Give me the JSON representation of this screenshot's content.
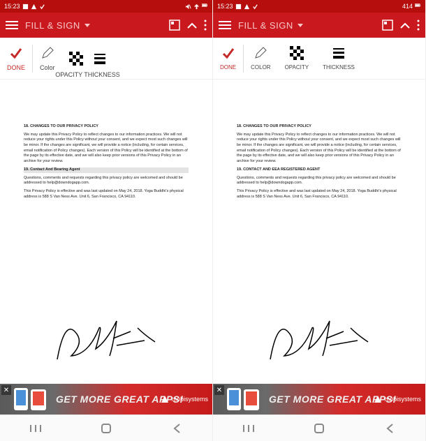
{
  "status": {
    "time": "15:23",
    "battery_right_a": "",
    "battery_right_b": "414"
  },
  "header": {
    "title": "FILL & SIGN"
  },
  "toolbar": {
    "left": {
      "done": "DONE",
      "color": "Color",
      "opacity": "OPACITY",
      "thickness": "THICKNESS",
      "opacity_thickness": "OPACITY THICKNESS"
    },
    "right": {
      "done": "DONE",
      "color": "COLOR",
      "opacity": "OPACITY",
      "thickness": "THICKNESS"
    }
  },
  "doc": {
    "section18_title": "18. CHANGES TO OUR PRIVACY POLICY",
    "section18_body": "We may update this Privacy Policy to reflect changes to our information practices. We will not reduce your rights under this Policy without your consent, and we expect most such changes will be minor. If the changes are significant, we will provide a notice (including, for certain services, email notification of Policy changes). Each version of this Policy will be identified at the bottom of the page by its effective date, and we will also keep prior versions of this Privacy Policy in an archive for your review.",
    "section19_title_a": "19. Contact And Bearing Agent",
    "section19_title_b": "19. CONTACT AND EEA REGISTERED AGENT",
    "section19_body1": "Questions, comments and requests regarding this privacy policy are welcomed and should be addressed to help@downdogapp.com.",
    "section19_body2": "This Privacy Policy is effective and was last updated on May 24, 2018. Yoga Buddhi's physical address is 588 S Van Ness Ave. Unit 6, San Francisco, CA 94110."
  },
  "ad": {
    "text": "GET MORE GREAT APPS!",
    "brand": "mobisystems"
  }
}
